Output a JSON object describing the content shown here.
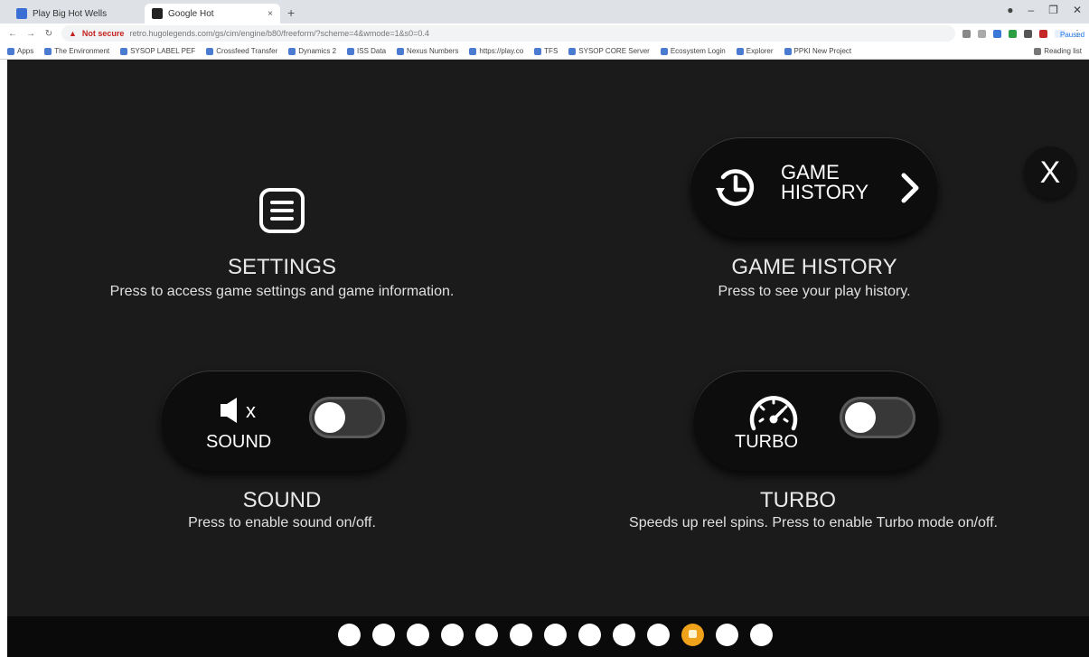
{
  "browser": {
    "tabs": [
      {
        "label": "Play Big Hot Wells"
      },
      {
        "label": "Google Hot"
      }
    ],
    "address": {
      "security": "Not secure",
      "url": "retro.hugolegends.com/gs/cim/engine/b80/freeform/?scheme=4&wmode=1&s0=0.4"
    },
    "paused_label": "Paused",
    "bookmarks": [
      "Apps",
      "The Environment",
      "SYSOP LABEL PEF",
      "Crossfeed Transfer",
      "Dynamics 2",
      "ISS Data",
      "Nexus Numbers",
      "https://play.co",
      "TFS",
      "SYSOP CORE Server",
      "Ecosystem Login",
      "Explorer",
      "PPKI New Project"
    ],
    "reading_list": "Reading list"
  },
  "game": {
    "close_label": "X",
    "settings": {
      "icon": "menu-icon",
      "title": "SETTINGS",
      "description": "Press to access game settings and game information."
    },
    "history": {
      "button_label_line1": "GAME",
      "button_label_line2": "HISTORY",
      "icon": "history-clock-icon",
      "title": "GAME HISTORY",
      "description": "Press to see your play history."
    },
    "sound": {
      "icon": "speaker-muted-icon",
      "icon_mark": "x",
      "button_label": "SOUND",
      "toggle_on": false,
      "title": "SOUND",
      "description": "Press to enable sound on/off."
    },
    "turbo": {
      "icon": "speedometer-icon",
      "button_label": "TURBO",
      "toggle_on": false,
      "title": "TURBO",
      "description": "Speeds up reel spins. Press to enable Turbo mode on/off."
    },
    "pagination": {
      "total": 13,
      "active_index": 10
    },
    "colors": {
      "background": "#1b1b1b",
      "active_dot": "#f0a21a",
      "dot": "#ffffff"
    }
  }
}
